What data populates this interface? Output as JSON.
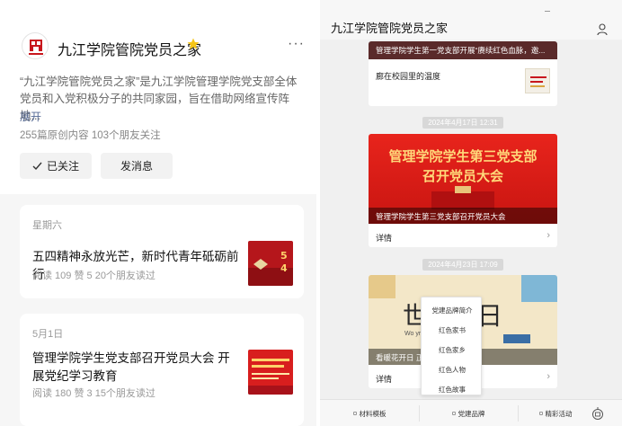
{
  "profile": {
    "name": "九江学院管院党员之家",
    "description": "“九江学院管院党员之家”是九江学院管理学院党支部全体党员和入党积极分子的共同家园，旨在借助网络宣传阵地...",
    "expand_label": "展开",
    "stats": "255篇原创内容  103个朋友关注",
    "followed_label": "已关注",
    "message_label": "发消息",
    "more_label": "···"
  },
  "feed": [
    {
      "date": "星期六",
      "title": "五四精神永放光芒，新时代青年砥砺前行",
      "meta": "阅读 109  赞 5  20个朋友读过"
    },
    {
      "date": "5月1日",
      "title": "管理学院学生党支部召开党员大会 开展党纪学习教育",
      "meta": "阅读 180  赞 3  15个朋友读过"
    }
  ],
  "chat": {
    "title": "九江学院管院党员之家",
    "msg0_banner": "管理学院学生第一党支部开展“赓续红色血脉，邀...",
    "msg0_sub": "廊在校园里的温度",
    "ts1": "2024年4月17日 12:31",
    "msg1_cover_title_1": "管理学院学生第三党支部",
    "msg1_cover_title_2": "召开党员大会",
    "msg1_caption": "管理学院学生第三党支部召开党员大会",
    "detail_label": "详情",
    "ts2": "2024年4月23日 17:09",
    "msg2_big": "世   书日",
    "msg2_world": "Wo              yright Day",
    "msg2_caption": "看暖花开日 正...",
    "popup_items": [
      "党建品牌简介",
      "红色家书",
      "红色家乡",
      "红色人物",
      "红色故事"
    ],
    "tabs": [
      "材料模板",
      "党建品牌",
      "精彩活动"
    ]
  },
  "colors": {
    "link": "#576b95",
    "star": "#f5c518",
    "red_cover": "#e8241c"
  }
}
